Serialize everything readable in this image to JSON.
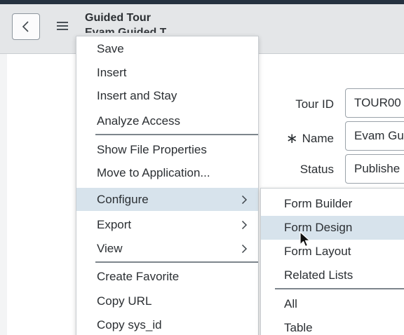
{
  "header": {
    "title": "Guided Tour",
    "subtitle": "Evam Guided T",
    "back_icon": "chevron-left-icon",
    "menu_icon": "hamburger-icon"
  },
  "form": {
    "tour_id_label": "Tour ID",
    "tour_id_value": "TOUR00",
    "name_required_mark": "∗",
    "name_label": "Name",
    "name_value": "Evam Gu",
    "status_label": "Status",
    "status_value": "Publishe"
  },
  "context_menu": {
    "items": [
      {
        "label": "Save"
      },
      {
        "label": "Insert"
      },
      {
        "label": "Insert and Stay"
      },
      {
        "label": "Analyze Access"
      },
      {
        "label": "Show File Properties"
      },
      {
        "label": "Move to Application..."
      },
      {
        "label": "Configure",
        "submenu": true,
        "active": true
      },
      {
        "label": "Export",
        "submenu": true
      },
      {
        "label": "View",
        "submenu": true
      },
      {
        "label": "Create Favorite"
      },
      {
        "label": "Copy URL"
      },
      {
        "label": "Copy sys_id"
      }
    ]
  },
  "configure_submenu": {
    "items": [
      {
        "label": "Form Builder"
      },
      {
        "label": "Form Design",
        "hovered": true
      },
      {
        "label": "Form Layout"
      },
      {
        "label": "Related Lists"
      },
      {
        "label": "All"
      },
      {
        "label": "Table"
      }
    ]
  },
  "colors": {
    "active_highlight": "#d7e3ec",
    "header_bg": "#e4e6e8",
    "text": "#2b2f33"
  }
}
